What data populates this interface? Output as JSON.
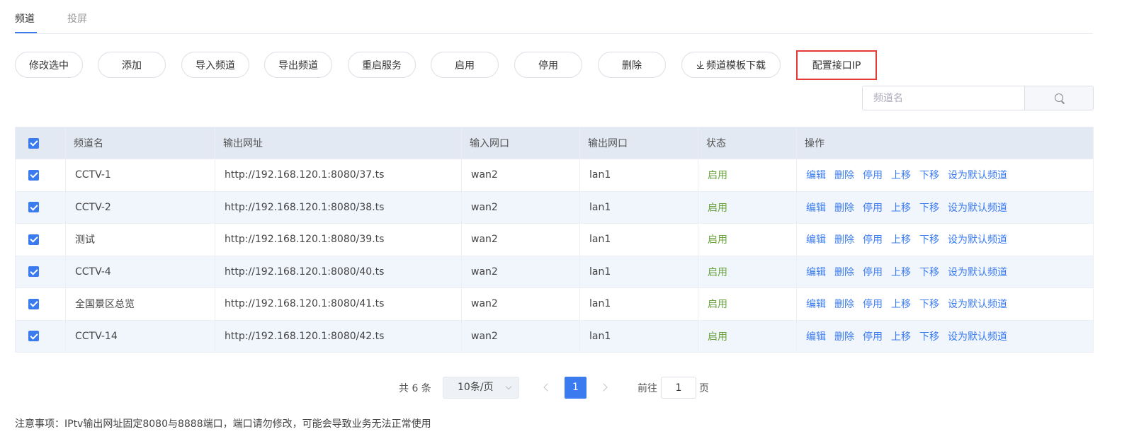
{
  "tabs": [
    {
      "label": "频道",
      "active": true
    },
    {
      "label": "投屏",
      "active": false
    }
  ],
  "toolbar": {
    "buttons": [
      "修改选中",
      "添加",
      "导入频道",
      "导出频道",
      "重启服务",
      "启用",
      "停用",
      "删除",
      "频道模板下载"
    ],
    "config_ip": "配置接口IP"
  },
  "search": {
    "placeholder": "频道名",
    "value": ""
  },
  "table": {
    "headers": [
      "频道名",
      "输出网址",
      "输入网口",
      "输出网口",
      "状态",
      "操作"
    ],
    "rows": [
      {
        "checked": true,
        "name": "CCTV-1",
        "url": "http://192.168.120.1:8080/37.ts",
        "input": "wan2",
        "output": "lan1",
        "status": "启用"
      },
      {
        "checked": true,
        "name": "CCTV-2",
        "url": "http://192.168.120.1:8080/38.ts",
        "input": "wan2",
        "output": "lan1",
        "status": "启用"
      },
      {
        "checked": true,
        "name": "测试",
        "url": "http://192.168.120.1:8080/39.ts",
        "input": "wan2",
        "output": "lan1",
        "status": "启用"
      },
      {
        "checked": true,
        "name": "CCTV-4",
        "url": "http://192.168.120.1:8080/40.ts",
        "input": "wan2",
        "output": "lan1",
        "status": "启用"
      },
      {
        "checked": true,
        "name": "全国景区总览",
        "url": "http://192.168.120.1:8080/41.ts",
        "input": "wan2",
        "output": "lan1",
        "status": "启用"
      },
      {
        "checked": true,
        "name": "CCTV-14",
        "url": "http://192.168.120.1:8080/42.ts",
        "input": "wan2",
        "output": "lan1",
        "status": "启用"
      }
    ],
    "actions": [
      "编辑",
      "删除",
      "停用",
      "上移",
      "下移",
      "设为默认频道"
    ]
  },
  "pagination": {
    "total": "共 6 条",
    "page_size": "10条/页",
    "current_page": "1",
    "goto_label": "前往",
    "goto_value": "1",
    "page_unit": "页"
  },
  "note": "注意事项：IPtv输出网址固定8080与8888端口，端口请勿修改，可能会导致业务无法正常使用",
  "colors": {
    "accent": "#3a7bf0",
    "status_enabled": "#67a13a",
    "highlight_border": "#e53935",
    "header_bg": "#e2e9f3",
    "row_alt_bg": "#f1f5fc"
  }
}
